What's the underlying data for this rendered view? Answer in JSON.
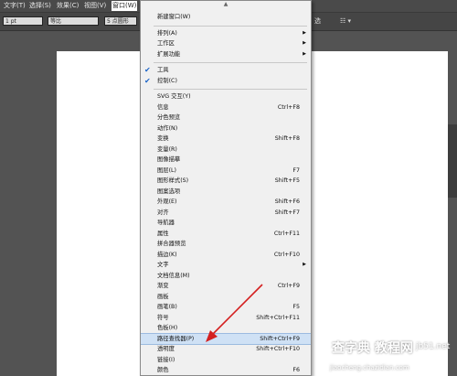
{
  "menubar": {
    "items": [
      "文字(T)",
      "选择(S)",
      "效果(C)",
      "视图(V)",
      "窗口(W)"
    ]
  },
  "ctrlbar": {
    "stroke_value": "1 pt",
    "line_style": "等比",
    "brush": "5 点圆形",
    "right_label": "选",
    "right_icon": "☷ ▾"
  },
  "menu": {
    "scroll_arrow": "▲",
    "items": [
      {
        "label": "新建窗口(W)",
        "shortcut": ""
      },
      {
        "label": "排列(A)",
        "shortcut": "",
        "submenu": true
      },
      {
        "label": "工作区",
        "shortcut": "",
        "submenu": true
      },
      {
        "label": "扩展功能",
        "shortcut": "",
        "submenu": true
      },
      {
        "label": "工具",
        "shortcut": "",
        "checked": true
      },
      {
        "label": "控制(C)",
        "shortcut": "",
        "checked": true
      },
      {
        "label": "SVG 交互(Y)",
        "shortcut": ""
      },
      {
        "label": "信息",
        "shortcut": "Ctrl+F8"
      },
      {
        "label": "分色预览",
        "shortcut": ""
      },
      {
        "label": "动作(N)",
        "shortcut": ""
      },
      {
        "label": "变换",
        "shortcut": "Shift+F8"
      },
      {
        "label": "变量(R)",
        "shortcut": ""
      },
      {
        "label": "图像描摹",
        "shortcut": ""
      },
      {
        "label": "图层(L)",
        "shortcut": "F7"
      },
      {
        "label": "图形样式(S)",
        "shortcut": "Shift+F5"
      },
      {
        "label": "图案选项",
        "shortcut": ""
      },
      {
        "label": "外观(E)",
        "shortcut": "Shift+F6"
      },
      {
        "label": "对齐",
        "shortcut": "Shift+F7"
      },
      {
        "label": "导航器",
        "shortcut": ""
      },
      {
        "label": "属性",
        "shortcut": "Ctrl+F11"
      },
      {
        "label": "拼合器预览",
        "shortcut": ""
      },
      {
        "label": "描边(K)",
        "shortcut": "Ctrl+F10"
      },
      {
        "label": "文字",
        "shortcut": "",
        "submenu": true
      },
      {
        "label": "文档信息(M)",
        "shortcut": ""
      },
      {
        "label": "渐变",
        "shortcut": "Ctrl+F9"
      },
      {
        "label": "画板",
        "shortcut": ""
      },
      {
        "label": "画笔(B)",
        "shortcut": "F5"
      },
      {
        "label": "符号",
        "shortcut": "Shift+Ctrl+F11"
      },
      {
        "label": "色板(H)",
        "shortcut": ""
      },
      {
        "label": "路径查找器(P)",
        "shortcut": "Shift+Ctrl+F9",
        "highlighted": true
      },
      {
        "label": "透明度",
        "shortcut": "Shift+Ctrl+F10"
      },
      {
        "label": "链接(I)",
        "shortcut": ""
      },
      {
        "label": "颜色",
        "shortcut": "F6"
      }
    ]
  },
  "watermark": {
    "line1": "查字典  教程网",
    "line2": "jiaocheng.chazidian.com",
    "site": "jb51.net"
  },
  "colors": {
    "arrow": "#d42020",
    "highlight": "#cfe1f5"
  }
}
